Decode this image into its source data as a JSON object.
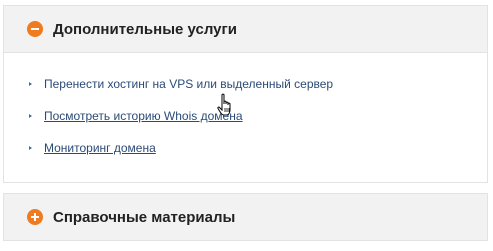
{
  "sections": [
    {
      "title": "Дополнительные услуги",
      "state": "expanded",
      "icon": "minus-circle-icon",
      "links": [
        {
          "label": "Перенести хостинг на VPS или выделенный сервер",
          "underlined": false
        },
        {
          "label": "Посмотреть историю Whois домена",
          "underlined": true
        },
        {
          "label": "Мониторинг домена",
          "underlined": true
        }
      ]
    },
    {
      "title": "Справочные материалы",
      "state": "collapsed",
      "icon": "plus-circle-icon"
    }
  ],
  "colors": {
    "accent": "#f07a1e",
    "link": "#2a4b78",
    "header_bg": "#f2f2f2",
    "border": "#e3e3e3"
  },
  "cursor": "hand-pointer-cursor-icon"
}
